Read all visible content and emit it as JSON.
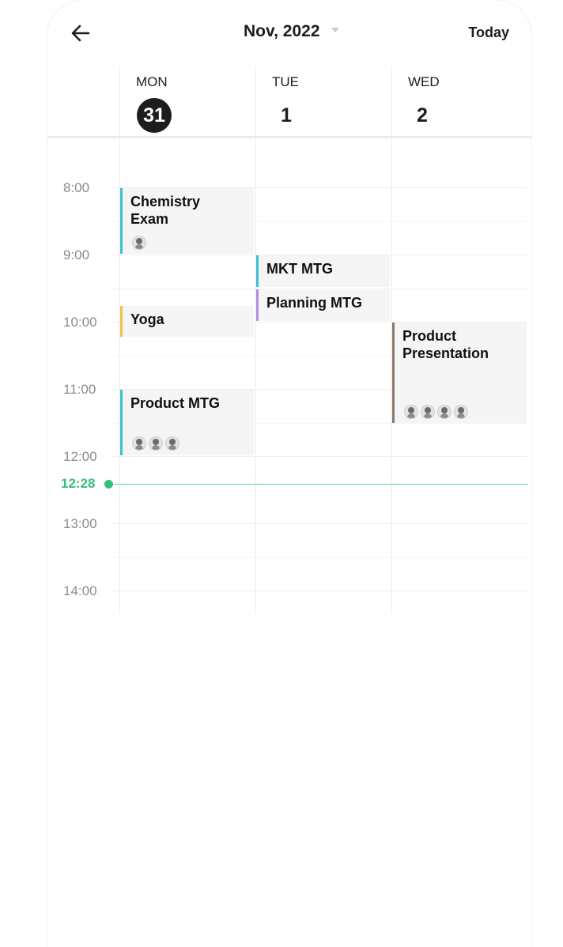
{
  "header": {
    "month_label": "Nov, 2022",
    "today_label": "Today"
  },
  "days": [
    {
      "dow": "MON",
      "num": "31",
      "selected": true
    },
    {
      "dow": "TUE",
      "num": "1",
      "selected": false
    },
    {
      "dow": "WED",
      "num": "2",
      "selected": false
    }
  ],
  "times": [
    "8:00",
    "9:00",
    "10:00",
    "11:00",
    "12:00",
    "13:00",
    "14:00"
  ],
  "now": {
    "label": "12:28",
    "color": "#34c07b"
  },
  "events": {
    "chemistry": {
      "title": "Chemistry Exam",
      "color": "#3cc0cc",
      "attendees": 1
    },
    "yoga": {
      "title": "Yoga",
      "color": "#f2c14e",
      "attendees": 0
    },
    "product_mtg": {
      "title": "Product MTG",
      "color": "#3cc0cc",
      "attendees": 3
    },
    "mkt_mtg": {
      "title": "MKT MTG",
      "color": "#3cc0cc",
      "attendees": 0
    },
    "planning_mtg": {
      "title": "Planning MTG",
      "color": "#b48ee0",
      "attendees": 0
    },
    "product_presentation": {
      "title": "Product Presentation",
      "color": "#8a7a70",
      "attendees": 4
    }
  }
}
